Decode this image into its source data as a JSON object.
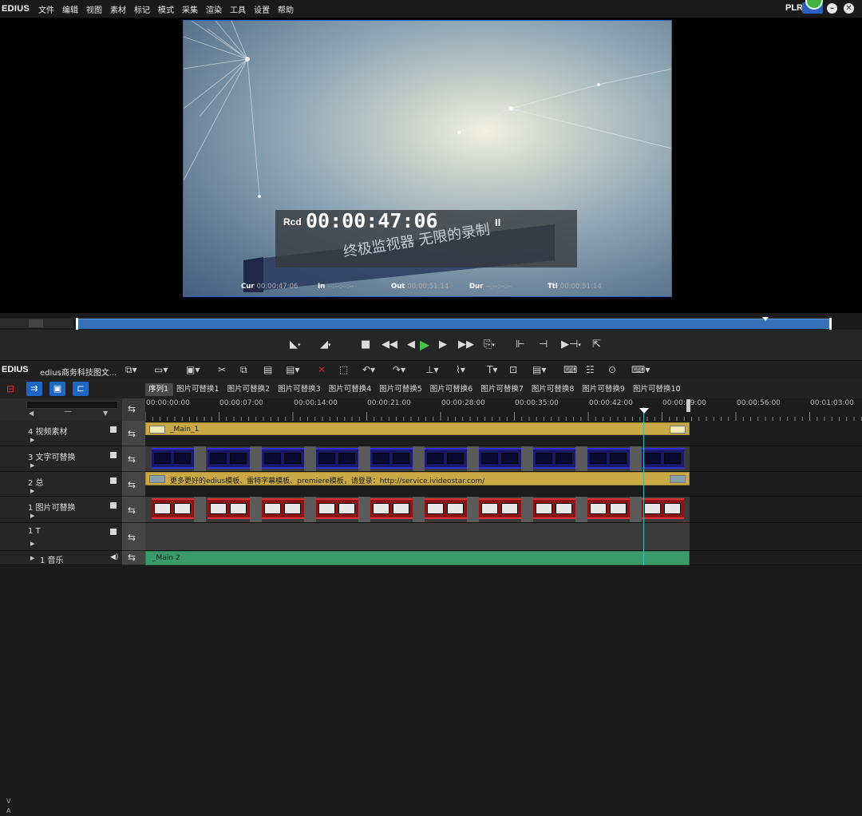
{
  "app": {
    "logo": "EDIUS",
    "plr_label": "PLR"
  },
  "menu": [
    "文件",
    "编辑",
    "视图",
    "素材",
    "标记",
    "模式",
    "采集",
    "渲染",
    "工具",
    "设置",
    "帮助"
  ],
  "window_buttons": {
    "minimize": "–",
    "close": "✕"
  },
  "preview": {
    "rcd_label": "Rcd",
    "rcd_time": "00:00:47:06",
    "pause_glyph": "II",
    "caption": "终极监视器 无限的录制"
  },
  "timecodes": {
    "cur_label": "Cur",
    "cur_value": "00:00:47:06",
    "in_label": "In",
    "in_value": "--:--:--:--",
    "out_label": "Out",
    "out_value": "00:00:51:14",
    "dur_label": "Dur",
    "dur_value": "--:--:--:--",
    "ttl_label": "Ttl",
    "ttl_value": "00:00:51:14"
  },
  "timeline": {
    "logo": "EDIUS",
    "project_name": "edius商务科技图文...",
    "sequence_tabs": [
      "序列1",
      "图片可替换1",
      "图片可替换2",
      "图片可替换3",
      "图片可替换4",
      "图片可替换5",
      "图片可替换6",
      "图片可替换7",
      "图片可替换8",
      "图片可替换9",
      "图片可替换10"
    ],
    "active_tab": "序列1",
    "va_labels": [
      "V",
      "A"
    ],
    "ruler_labels": [
      "00:00:00:00",
      "00:00:07:00",
      "00:00:14:00",
      "00:00:21:00",
      "00:00:28:00",
      "00:00:35:00",
      "00:00:42:00",
      "00:00:49:00",
      "00:00:56:00",
      "00:01:03:00"
    ],
    "tracks": [
      {
        "name": "4 视频素材",
        "clip_label": "_Main_1"
      },
      {
        "name": "3 文字可替换",
        "clip_label": ""
      },
      {
        "name": "2 总",
        "clip_label": "更多更好的edius模板、雷特字幕模板、premiere模板，请登录：http://service.ivideostar.com/"
      },
      {
        "name": "1 图片可替换",
        "clip_label": ""
      },
      {
        "name": "1 T",
        "clip_label": ""
      },
      {
        "name": "1 音乐",
        "clip_label": "_Main 2"
      }
    ]
  },
  "colors": {
    "accent": "#3671b7",
    "title_clip": "#c9a945",
    "audio_clip": "#3a9a6c",
    "playhead": "#34c0b5"
  }
}
